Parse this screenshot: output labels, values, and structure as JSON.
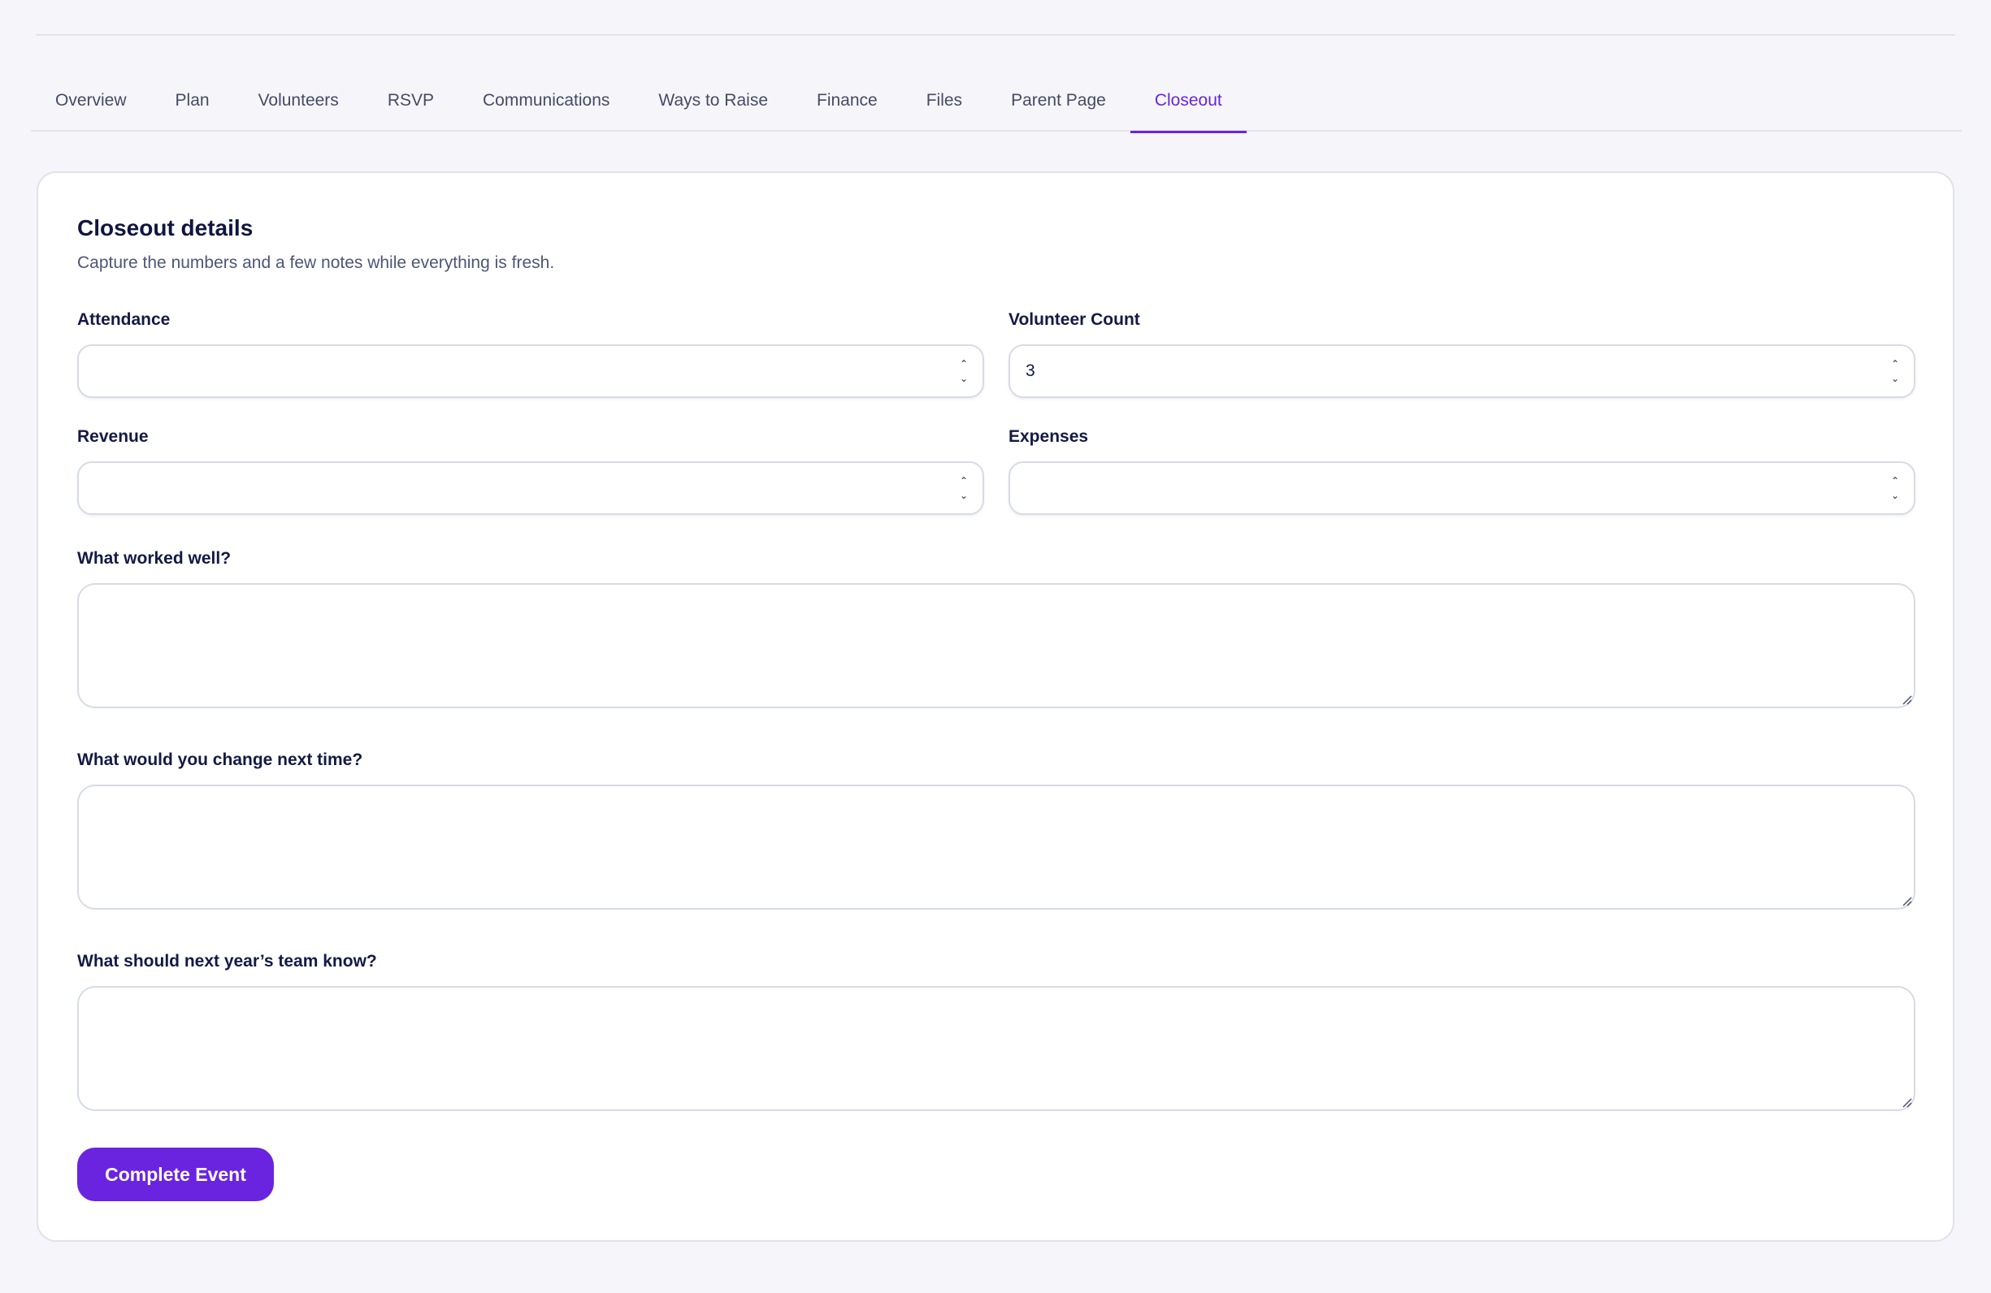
{
  "tabs": [
    {
      "label": "Overview"
    },
    {
      "label": "Plan"
    },
    {
      "label": "Volunteers"
    },
    {
      "label": "RSVP"
    },
    {
      "label": "Communications"
    },
    {
      "label": "Ways to Raise"
    },
    {
      "label": "Finance"
    },
    {
      "label": "Files"
    },
    {
      "label": "Parent Page"
    },
    {
      "label": "Closeout",
      "active": true
    }
  ],
  "form": {
    "title": "Closeout details",
    "subtitle": "Capture the numbers and a few notes while everything is fresh.",
    "attendance": {
      "label": "Attendance",
      "value": ""
    },
    "volunteer_count": {
      "label": "Volunteer Count",
      "value": "3"
    },
    "revenue": {
      "label": "Revenue",
      "value": ""
    },
    "expenses": {
      "label": "Expenses",
      "value": ""
    },
    "worked_well": {
      "label": "What worked well?",
      "value": ""
    },
    "change_next": {
      "label": "What would you change next time?",
      "value": ""
    },
    "next_team": {
      "label": "What should next year’s team know?",
      "value": ""
    },
    "submit_label": "Complete Event"
  },
  "colors": {
    "accent": "#6a24df",
    "background": "#f6f6fa",
    "text": "#101540"
  },
  "icons": {
    "spinner": "number-spinner-icon",
    "resize": "resize-grip-icon"
  }
}
